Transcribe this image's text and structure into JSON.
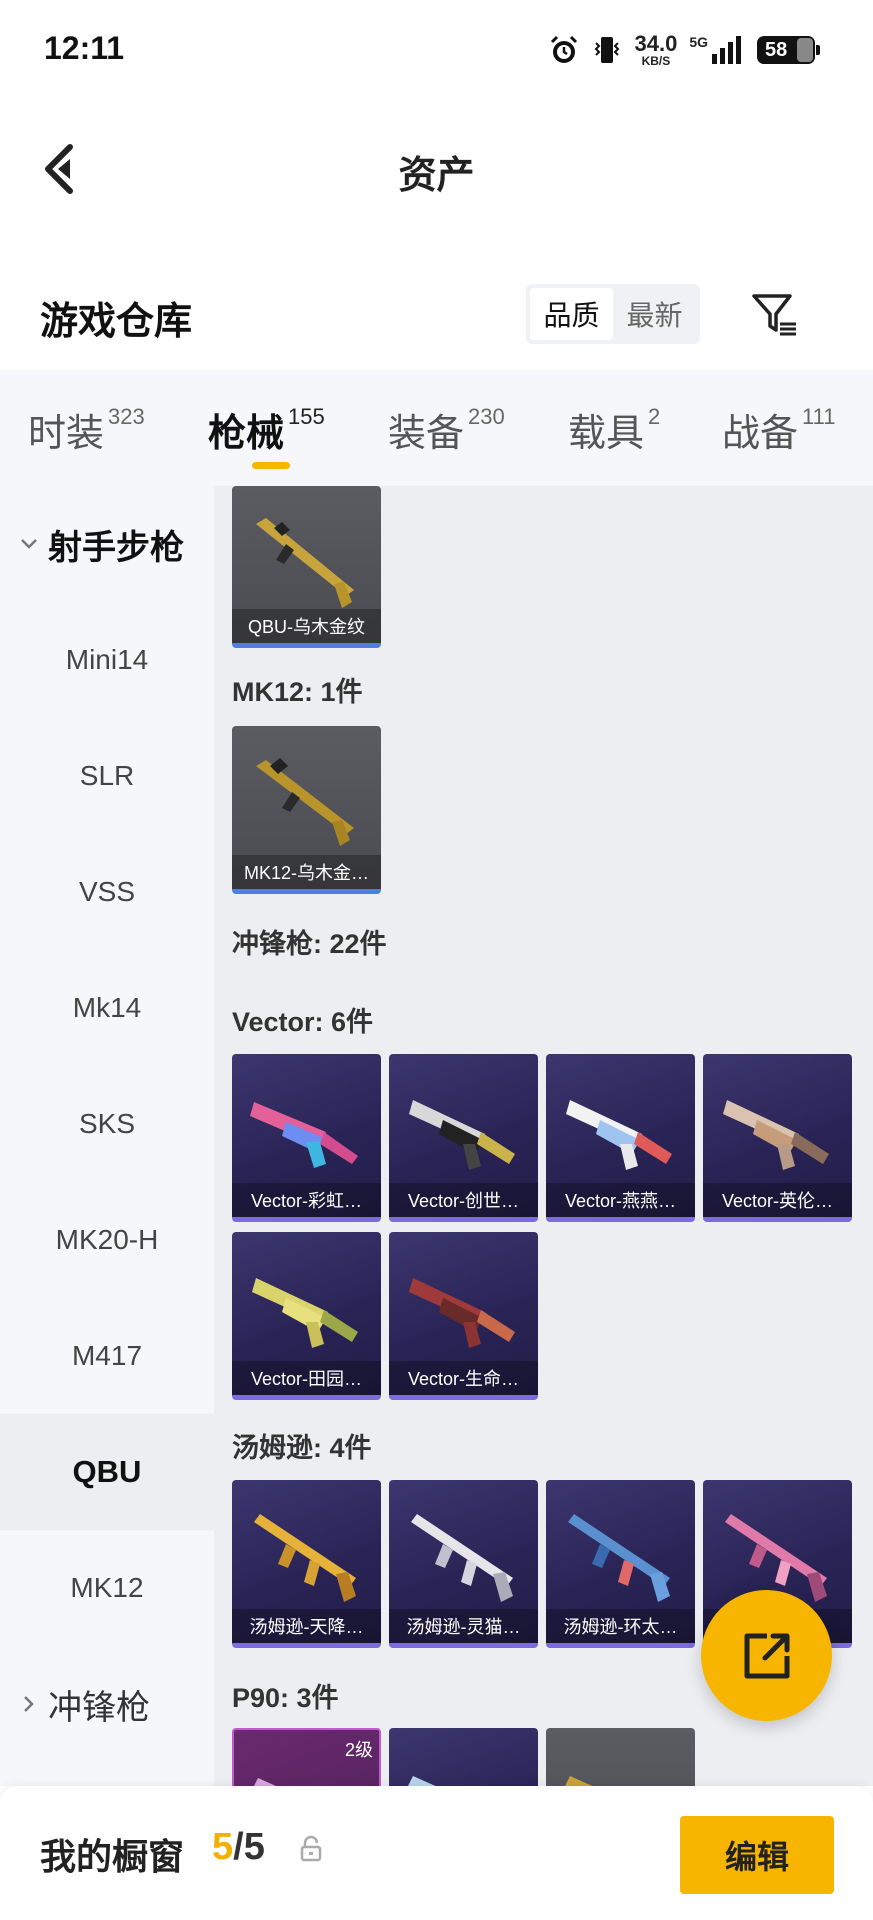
{
  "status_bar": {
    "time": "12:11",
    "net_speed": "34.0",
    "net_unit": "KB/S",
    "signal_label": "5G",
    "battery": "58"
  },
  "nav": {
    "title": "资产"
  },
  "warehouse": {
    "title": "游戏仓库",
    "sort_options": [
      "品质",
      "最新"
    ],
    "active_sort": "品质"
  },
  "tabs": [
    {
      "label": "时装",
      "count": "323"
    },
    {
      "label": "枪械",
      "count": "155",
      "active": true
    },
    {
      "label": "装备",
      "count": "230"
    },
    {
      "label": "载具",
      "count": "2"
    },
    {
      "label": "战备",
      "count": "111"
    }
  ],
  "sidebar": {
    "groups": [
      {
        "label": "射手步枪",
        "expanded": true
      },
      {
        "label": "冲锋枪",
        "expanded": false
      }
    ],
    "items": [
      "Mini14",
      "SLR",
      "VSS",
      "Mk14",
      "SKS",
      "MK20-H",
      "M417",
      "QBU",
      "MK12"
    ],
    "active_item": "QBU"
  },
  "sections": [
    {
      "title": "",
      "items": [
        {
          "label": "QBU-乌木金纹",
          "rarity": "gray"
        }
      ]
    },
    {
      "title": "MK12: 1件",
      "items": [
        {
          "label": "MK12-乌木金…",
          "rarity": "gray"
        }
      ]
    },
    {
      "title": "冲锋枪: 22件",
      "items": []
    },
    {
      "title": "Vector: 6件",
      "items": [
        {
          "label": "Vector-彩虹…",
          "rarity": "purple"
        },
        {
          "label": "Vector-创世…",
          "rarity": "purple"
        },
        {
          "label": "Vector-燕燕…",
          "rarity": "purple"
        },
        {
          "label": "Vector-英伦…",
          "rarity": "purple"
        },
        {
          "label": "Vector-田园…",
          "rarity": "purple"
        },
        {
          "label": "Vector-生命…",
          "rarity": "purple"
        }
      ]
    },
    {
      "title": "汤姆逊: 4件",
      "items": [
        {
          "label": "汤姆逊-天降…",
          "rarity": "purple"
        },
        {
          "label": "汤姆逊-灵猫…",
          "rarity": "purple"
        },
        {
          "label": "汤姆逊-环太…",
          "rarity": "purple"
        },
        {
          "label": "",
          "rarity": "purple"
        }
      ]
    },
    {
      "title": "P90: 3件",
      "items": [
        {
          "label": "",
          "rarity": "pink",
          "level": "2级"
        },
        {
          "label": "",
          "rarity": "purple"
        },
        {
          "label": "",
          "rarity": "gray"
        }
      ]
    }
  ],
  "bottom_bar": {
    "label": "我的橱窗",
    "current": "5",
    "separator": "/",
    "total": "5",
    "edit_label": "编辑"
  },
  "colors": {
    "accent": "#f7b500",
    "rarity_gray_bar": "#4d7fe0",
    "rarity_purple_bar": "#7c6ae0"
  },
  "icons": [
    "back-arrow-icon",
    "filter-icon",
    "chevron-down-icon",
    "chevron-right-icon",
    "share-icon",
    "lock-icon",
    "alarm-icon",
    "vibrate-icon",
    "signal-icon",
    "battery-icon"
  ]
}
